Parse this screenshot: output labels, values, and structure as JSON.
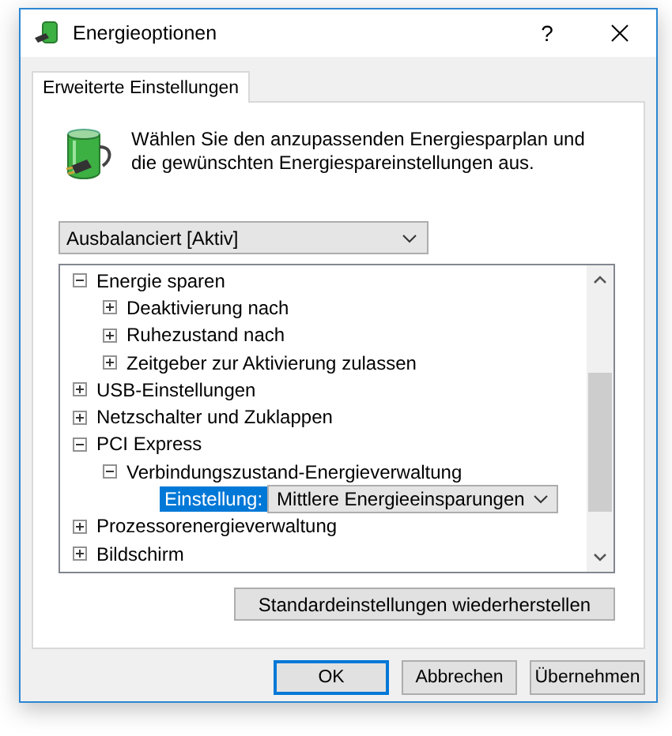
{
  "window": {
    "title": "Energieoptionen",
    "help": "?"
  },
  "tabs": [
    {
      "label": "Erweiterte Einstellungen",
      "selected": true
    }
  ],
  "intro": "Wählen Sie den anzupassenden Energiesparplan und die gewünschten Energiespareinstellungen aus.",
  "plan_select": {
    "value": "Ausbalanciert [Aktiv]"
  },
  "tree": [
    {
      "label": "Energie sparen",
      "expanded": true,
      "children": [
        {
          "label": "Deaktivierung nach",
          "expanded": false
        },
        {
          "label": "Ruhezustand nach",
          "expanded": false
        },
        {
          "label": "Zeitgeber zur Aktivierung zulassen",
          "expanded": false
        }
      ]
    },
    {
      "label": "USB-Einstellungen",
      "expanded": false
    },
    {
      "label": "Netzschalter und Zuklappen",
      "expanded": false
    },
    {
      "label": "PCI Express",
      "expanded": true,
      "children": [
        {
          "label": "Verbindungszustand-Energieverwaltung",
          "expanded": true,
          "children": [
            {
              "kind": "setting",
              "label": "Einstellung:",
              "value": "Mittlere Energieeinsparungen",
              "selected": true
            }
          ]
        }
      ]
    },
    {
      "label": "Prozessorenergieverwaltung",
      "expanded": false
    },
    {
      "label": "Bildschirm",
      "expanded": false
    }
  ],
  "restore_button": "Standardeinstellungen wiederherstellen",
  "buttons": [
    {
      "label": "OK",
      "default": true
    },
    {
      "label": "Abbrechen",
      "default": false
    },
    {
      "label": "Übernehmen",
      "default": false
    }
  ]
}
